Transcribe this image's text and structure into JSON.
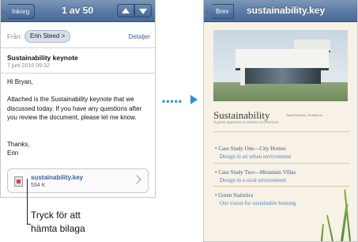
{
  "mail": {
    "back_label": "Inkorg",
    "title": "1 av 50",
    "prev_icon": "arrow-up-icon",
    "next_icon": "arrow-down-icon",
    "from_label": "Från:",
    "from_name": "Erin Steed >",
    "details_label": "Detaljer",
    "subject": "Sustainability keynote",
    "date": "7 juni 2010 09:32",
    "greeting": "Hi Bryan,",
    "body": "Attached is the Sustainability keynote that we discussed today. If you have any questions after you review the document, please let me know.",
    "signoff": "Thanks,",
    "signature": "Erin",
    "attachment": {
      "name": "sustainability.key",
      "size": "534 K",
      "icon": "keynote-file-icon"
    }
  },
  "callout": {
    "line1": "Tryck för att",
    "line2": "hämta bilaga"
  },
  "keynote": {
    "back_label": "Brev",
    "title": "sustainability.key",
    "doc_title": "Sustainability",
    "doc_authors": "Jason Roberts, Architects",
    "doc_subtitle": "A green approach to modern architecture",
    "items": [
      {
        "title": "Case Study One—City Homes",
        "subtitle": "Design in an urban environment"
      },
      {
        "title": "Case Study Two—Mountain Villas",
        "subtitle": "Design in a rural environment"
      },
      {
        "title": "Green Statistics",
        "subtitle": "Our vision for sustainable housing"
      }
    ]
  },
  "colors": {
    "nav_bar": "#5a7aa4",
    "arrow": "#2d8fd6",
    "link": "#3a62a6"
  }
}
